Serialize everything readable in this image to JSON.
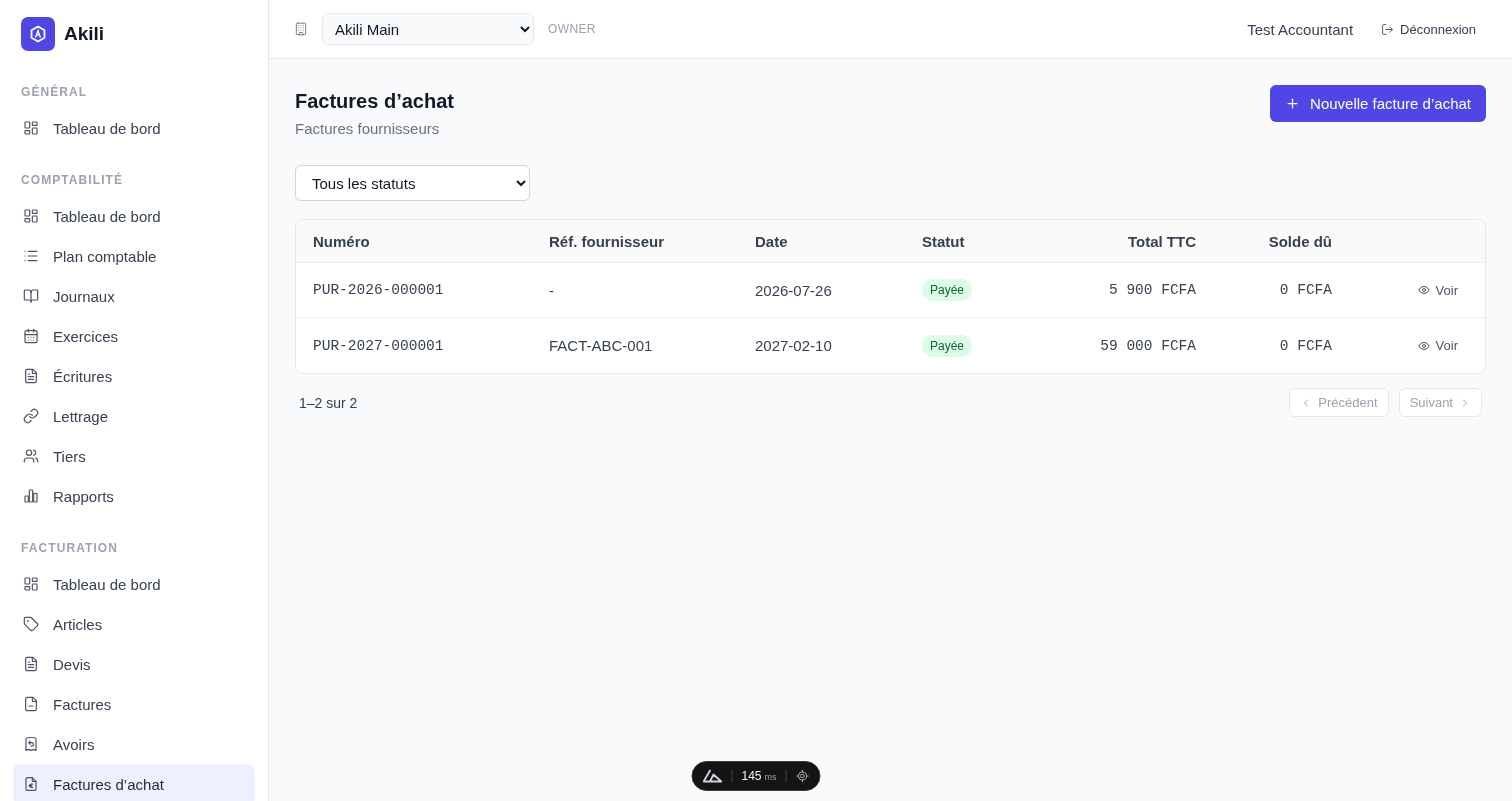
{
  "sidebar": {
    "brand": "Akili",
    "sections": [
      {
        "title": "GÉNÉRAL",
        "items": [
          {
            "label": "Tableau de bord",
            "selected": false
          }
        ]
      },
      {
        "title": "COMPTABILITÉ",
        "items": [
          {
            "label": "Tableau de bord",
            "selected": false
          },
          {
            "label": "Plan comptable",
            "selected": false
          },
          {
            "label": "Journaux",
            "selected": false
          },
          {
            "label": "Exercices",
            "selected": false
          },
          {
            "label": "Écritures",
            "selected": false
          },
          {
            "label": "Lettrage",
            "selected": false
          },
          {
            "label": "Tiers",
            "selected": false
          },
          {
            "label": "Rapports",
            "selected": false
          }
        ]
      },
      {
        "title": "FACTURATION",
        "items": [
          {
            "label": "Tableau de bord",
            "selected": false
          },
          {
            "label": "Articles",
            "selected": false
          },
          {
            "label": "Devis",
            "selected": false
          },
          {
            "label": "Factures",
            "selected": false
          },
          {
            "label": "Avoirs",
            "selected": false
          },
          {
            "label": "Factures d’achat",
            "selected": true
          }
        ]
      }
    ]
  },
  "topbar": {
    "organization": {
      "value": "Akili Main"
    },
    "role": "OWNER",
    "user": "Test Accountant",
    "logout": "Déconnexion"
  },
  "page": {
    "title": "Factures d’achat",
    "subtitle": "Factures fournisseurs",
    "new_button": "Nouvelle facture d’achat"
  },
  "filter": {
    "value": "Tous les statuts"
  },
  "table": {
    "columns": [
      "Numéro",
      "Réf. fournisseur",
      "Date",
      "Statut",
      "Total TTC",
      "Solde dû"
    ],
    "rows": [
      {
        "number": "PUR-2026-000001",
        "supplier_ref": "-",
        "date": "2026-07-26",
        "status": {
          "label": "Payée",
          "kind": "paid"
        },
        "total": "5 900 FCFA",
        "balance": "0 FCFA",
        "action": "Voir"
      },
      {
        "number": "PUR-2027-000001",
        "supplier_ref": "FACT-ABC-001",
        "date": "2027-02-10",
        "status": {
          "label": "Payée",
          "kind": "paid"
        },
        "total": "59 000 FCFA",
        "balance": "0 FCFA",
        "action": "Voir"
      }
    ]
  },
  "pagination": {
    "summary": "1–2 sur 2",
    "previous": {
      "label": "Précédent",
      "disabled": true
    },
    "next": {
      "label": "Suivant",
      "disabled": true
    }
  },
  "devtools": {
    "value": "145",
    "unit": "ms"
  }
}
